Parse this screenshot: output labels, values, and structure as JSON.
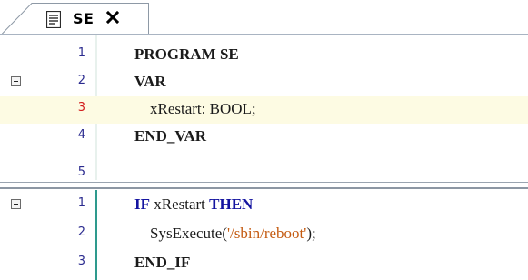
{
  "tab": {
    "title": "SE",
    "icon": "document-icon",
    "close_icon": "close-icon"
  },
  "declaration": {
    "lines": [
      {
        "num": "1",
        "text": "PROGRAM SE"
      },
      {
        "num": "2",
        "text": "VAR"
      },
      {
        "num": "3",
        "text": "    xRestart: BOOL;"
      },
      {
        "num": "4",
        "text": "END_VAR"
      },
      {
        "num": "5",
        "text": ""
      }
    ]
  },
  "implementation": {
    "lines": [
      {
        "num": "1",
        "kw1": "IF",
        "mid": " xRestart ",
        "kw2": "THEN"
      },
      {
        "num": "2",
        "fn": "    SysExecute(",
        "str": "'/sbin/reboot'",
        "tail": ");"
      },
      {
        "num": "3",
        "text": "END_IF"
      }
    ]
  },
  "colors": {
    "keyword": "#1414a0",
    "string": "#c45a10",
    "current_line": "#fdfbe3",
    "change_bar": "#2e9a8d",
    "line_number": "#2b2b8f",
    "current_line_number": "#d21c1c"
  }
}
